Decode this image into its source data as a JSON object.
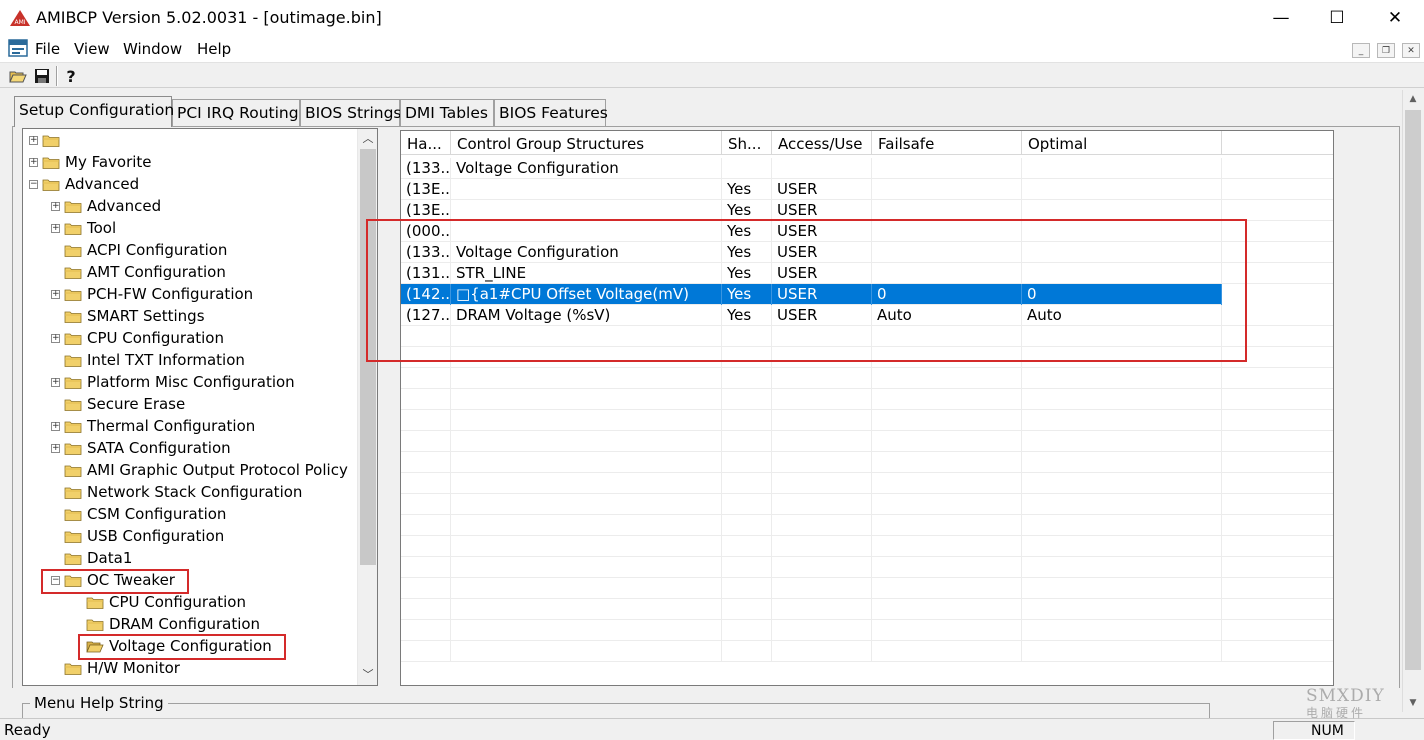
{
  "window": {
    "title": "AMIBCP Version 5.02.0031 - [outimage.bin]",
    "minimize": "—",
    "maximize": "☐",
    "close": "✕"
  },
  "menu": {
    "items": [
      "File",
      "View",
      "Window",
      "Help"
    ],
    "mdi_minimize": "_",
    "mdi_restore": "❐",
    "mdi_close": "✕"
  },
  "toolbar": {
    "icons": [
      "open-folder-icon",
      "save-disk-icon",
      "context-help-icon"
    ]
  },
  "tabs": [
    {
      "label": "Setup Configuration",
      "active": true
    },
    {
      "label": "PCI IRQ Routing",
      "active": false
    },
    {
      "label": "BIOS Strings",
      "active": false
    },
    {
      "label": "DMI Tables",
      "active": false
    },
    {
      "label": "BIOS Features",
      "active": false
    }
  ],
  "tree": {
    "items": [
      {
        "label": "",
        "level": 0,
        "expander": "+"
      },
      {
        "label": "My Favorite",
        "level": 0,
        "expander": "+"
      },
      {
        "label": "Advanced",
        "level": 0,
        "expander": "−"
      },
      {
        "label": "Advanced",
        "level": 1,
        "expander": "+"
      },
      {
        "label": "Tool",
        "level": 1,
        "expander": "+"
      },
      {
        "label": "ACPI Configuration",
        "level": 1,
        "expander": ""
      },
      {
        "label": "AMT Configuration",
        "level": 1,
        "expander": ""
      },
      {
        "label": "PCH-FW Configuration",
        "level": 1,
        "expander": "+"
      },
      {
        "label": "SMART Settings",
        "level": 1,
        "expander": ""
      },
      {
        "label": "CPU Configuration",
        "level": 1,
        "expander": "+"
      },
      {
        "label": "Intel TXT Information",
        "level": 1,
        "expander": ""
      },
      {
        "label": "Platform Misc Configuration",
        "level": 1,
        "expander": "+"
      },
      {
        "label": "Secure Erase",
        "level": 1,
        "expander": ""
      },
      {
        "label": "Thermal Configuration",
        "level": 1,
        "expander": "+"
      },
      {
        "label": "SATA Configuration",
        "level": 1,
        "expander": "+"
      },
      {
        "label": "AMI Graphic Output Protocol Policy",
        "level": 1,
        "expander": ""
      },
      {
        "label": "Network Stack Configuration",
        "level": 1,
        "expander": ""
      },
      {
        "label": "CSM Configuration",
        "level": 1,
        "expander": ""
      },
      {
        "label": "USB Configuration",
        "level": 1,
        "expander": ""
      },
      {
        "label": "Data1",
        "level": 1,
        "expander": ""
      },
      {
        "label": "OC Tweaker",
        "level": 1,
        "expander": "−"
      },
      {
        "label": "CPU Configuration",
        "level": 2,
        "expander": ""
      },
      {
        "label": "DRAM Configuration",
        "level": 2,
        "expander": ""
      },
      {
        "label": "Voltage Configuration",
        "level": 2,
        "expander": "",
        "open": true
      },
      {
        "label": "H/W Monitor",
        "level": 1,
        "expander": ""
      }
    ]
  },
  "grid": {
    "columns": [
      "Ha...",
      "Control Group Structures",
      "Sh...",
      "Access/Use",
      "Failsafe",
      "Optimal"
    ],
    "rows": [
      {
        "cells": [
          "(133...",
          "Voltage Configuration",
          "",
          "",
          "",
          ""
        ],
        "selected": false
      },
      {
        "cells": [
          "(13E...",
          "",
          "Yes",
          "USER",
          "",
          ""
        ],
        "selected": false
      },
      {
        "cells": [
          "(13E...",
          "",
          "Yes",
          "USER",
          "",
          ""
        ],
        "selected": false
      },
      {
        "cells": [
          "(000...",
          "",
          "Yes",
          "USER",
          "",
          ""
        ],
        "selected": false
      },
      {
        "cells": [
          "(133...",
          "Voltage Configuration",
          "Yes",
          "USER",
          "",
          ""
        ],
        "selected": false
      },
      {
        "cells": [
          "(131...",
          "STR_LINE",
          "Yes",
          "USER",
          "",
          ""
        ],
        "selected": false
      },
      {
        "cells": [
          "(142...",
          "□{a1#CPU Offset Voltage(mV)",
          "Yes",
          "USER",
          "0",
          "0"
        ],
        "selected": true
      },
      {
        "cells": [
          "(127...",
          "DRAM Voltage (%sV)",
          "Yes",
          "USER",
          "Auto",
          "Auto"
        ],
        "selected": false
      }
    ],
    "empty_rows": 16
  },
  "help": {
    "label": "Menu Help String"
  },
  "status": {
    "text": "Ready",
    "num": "NUM"
  },
  "watermark": {
    "text": "SMXDIY",
    "sub": "电脑硬件"
  },
  "colors": {
    "selection": "#0078d7",
    "highlight_box": "#d42a2a",
    "folder": "#f1d06a"
  }
}
